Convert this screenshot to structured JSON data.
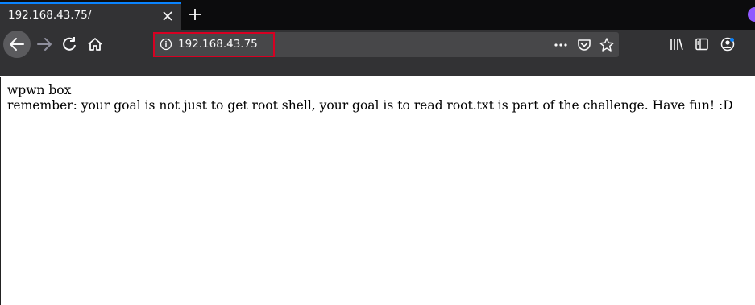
{
  "tab": {
    "title": "192.168.43.75/"
  },
  "url_bar": {
    "url": "192.168.43.75"
  },
  "icons": {
    "tab_close": "close-icon",
    "new_tab": "plus-icon",
    "back": "arrow-left-icon",
    "forward": "arrow-right-icon",
    "reload": "reload-icon",
    "home": "home-icon",
    "site_info": "info-icon",
    "page_actions": "more-horizontal-icon",
    "pocket": "pocket-icon",
    "bookmark": "star-icon",
    "library": "library-icon",
    "sidebar": "sidebar-icon",
    "account": "account-icon"
  },
  "colors": {
    "highlight": "#d70022",
    "tab_accent": "#0a84ff",
    "toolbar": "#323234",
    "tabstrip": "#0c0c0d"
  },
  "page": {
    "line1": "wpwn box",
    "line2": "remember: your goal is not just to get root shell, your goal is to read root.txt is part of the challenge. Have fun! :D"
  }
}
